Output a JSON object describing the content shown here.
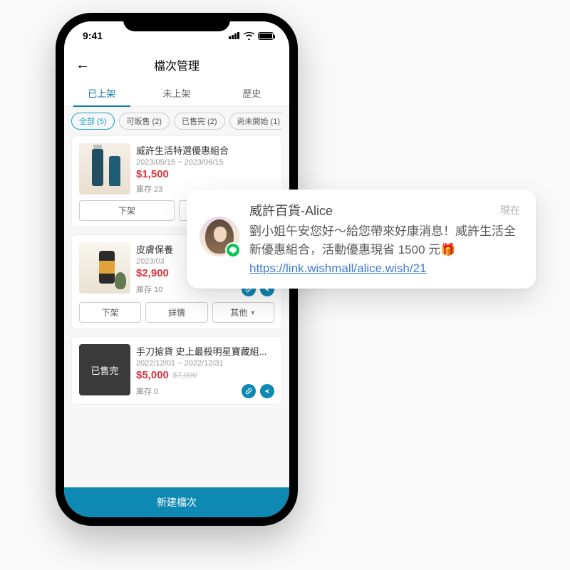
{
  "status": {
    "time": "9:41"
  },
  "nav": {
    "title": "檔次管理"
  },
  "tabs": [
    {
      "label": "已上架",
      "active": true
    },
    {
      "label": "未上架",
      "active": false
    },
    {
      "label": "歷史",
      "active": false
    }
  ],
  "chips": [
    {
      "label": "全部 (5)",
      "active": true
    },
    {
      "label": "可販售 (2)",
      "active": false
    },
    {
      "label": "已售完 (2)",
      "active": false
    },
    {
      "label": "尚未開始 (1)",
      "active": false
    }
  ],
  "products": [
    {
      "title": "威許生活特選優惠組合",
      "date": "2023/05/15 ~ 2023/06/15",
      "price": "$1,500",
      "orig": "",
      "stock": "庫存 23",
      "soldout": false
    },
    {
      "title": "皮膚保養",
      "date": "2023/03",
      "price": "$2,900",
      "orig": "",
      "stock": "庫存 10",
      "soldout": false
    },
    {
      "title": "手刀搶貨 史上最殺明星寶藏組...",
      "date": "2022/12/01 ~ 2022/12/31",
      "price": "$5,000",
      "orig": "$7,000",
      "stock": "庫存 0",
      "soldout": true,
      "soldout_label": "已售完"
    }
  ],
  "actions": {
    "unlist": "下架",
    "detail": "詳情",
    "other": "其他",
    "detail_short": "詳"
  },
  "bottom": {
    "new": "新建檔次"
  },
  "notif": {
    "title": "威許百貨-Alice",
    "time": "現在",
    "message": "劉小姐午安您好～給您帶來好康消息！威許生活全新優惠組合，活動優惠現省 1500 元",
    "gift": "🎁",
    "link": "https://link.wishmall/alice.wish/21"
  }
}
